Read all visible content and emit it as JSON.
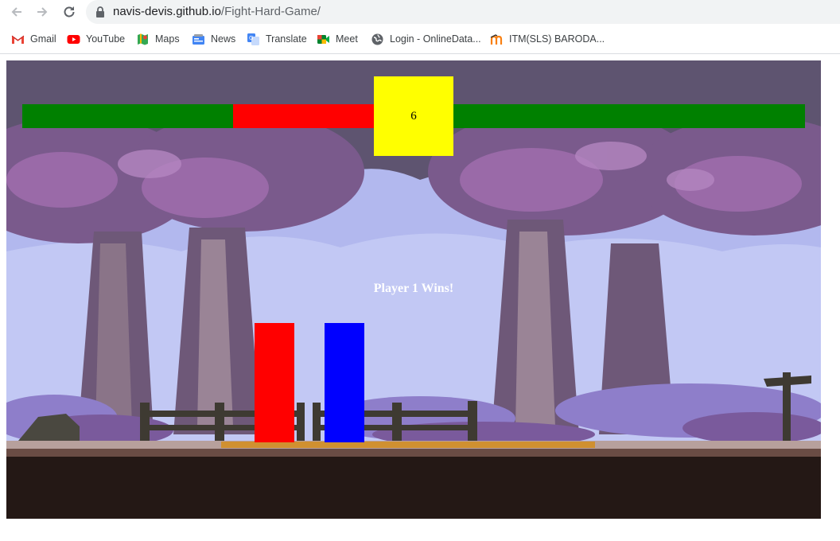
{
  "browser": {
    "url_host": "navis-devis.github.io",
    "url_path": "/Fight-Hard-Game/",
    "bookmarks": [
      {
        "label": "Gmail",
        "icon": "gmail-icon"
      },
      {
        "label": "YouTube",
        "icon": "youtube-icon"
      },
      {
        "label": "Maps",
        "icon": "maps-icon"
      },
      {
        "label": "News",
        "icon": "news-icon"
      },
      {
        "label": "Translate",
        "icon": "translate-icon"
      },
      {
        "label": "Meet",
        "icon": "meet-icon"
      },
      {
        "label": "Login - OnlineData...",
        "icon": "globe-icon"
      },
      {
        "label": "ITM(SLS) BARODA...",
        "icon": "moodle-icon"
      }
    ]
  },
  "game": {
    "timer": "6",
    "result_text": "Player 1 Wins!",
    "player1_health_fraction": 0.6,
    "player2_health_fraction": 1.0,
    "colors": {
      "health_fill": "#008000",
      "health_damage": "#ff0000",
      "timer_bg": "#ffff00",
      "player1": "#ff0000",
      "player2": "#0000ff",
      "sky": "#5e5470"
    }
  }
}
